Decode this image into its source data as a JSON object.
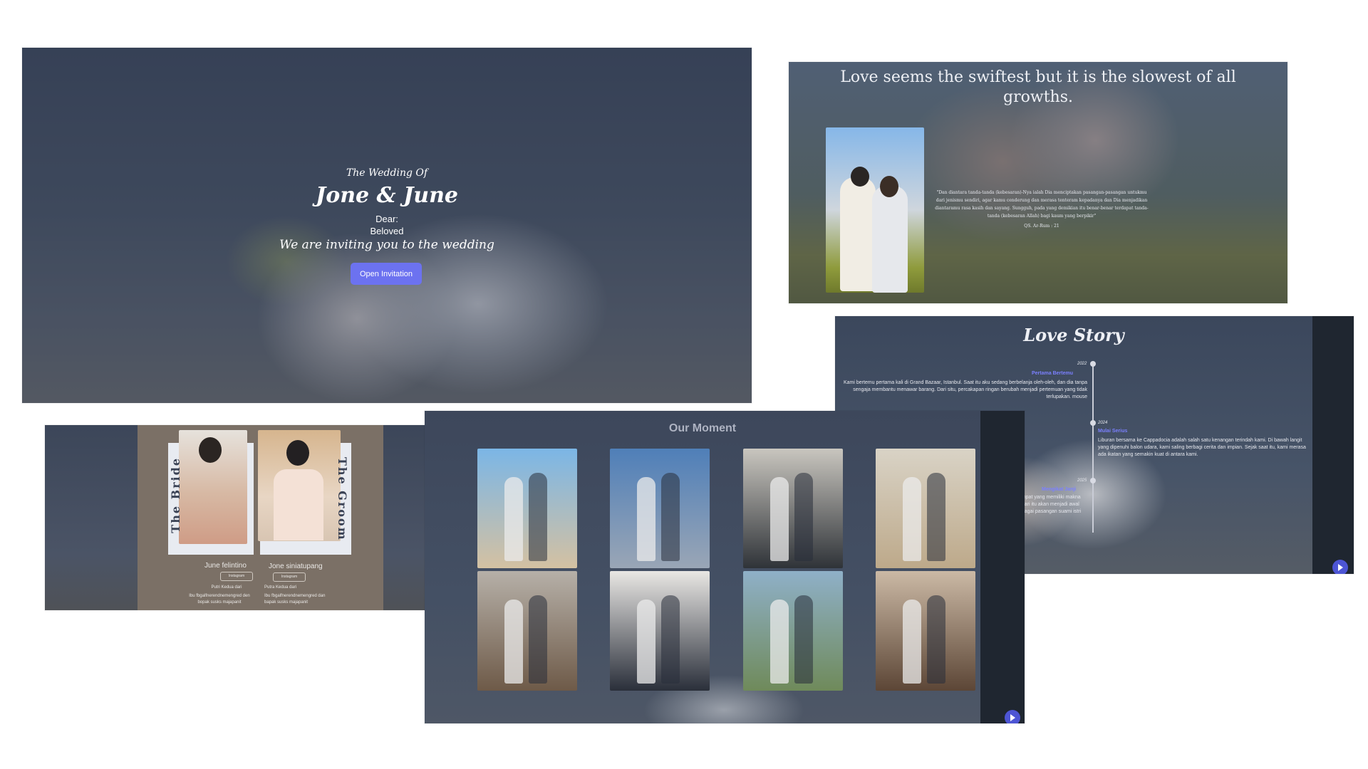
{
  "hero": {
    "subtitle": "The Wedding Of",
    "names": "Jone & June",
    "dear": "Dear:",
    "guest": "Beloved",
    "invite": "We are inviting you to the wedding",
    "button": "Open Invitation"
  },
  "quote": {
    "headline": "Love seems the swiftest but it is the slowest of all growths.",
    "verse": "\"Dan diantara tanda-tanda (kebesaran)-Nya ialah Dia menciptakan pasangan-pasangan untukmu dari jenismu sendiri, agar kamu cenderung dan merasa tenteram kepadanya dan Dia menjadikan diantaramu rasa kasih dan sayang. Sungguh, pada yang demikian itu benar-benar terdapat tanda-tanda (kebesaran Allah) bagi kaum yang berpikir\"",
    "source": "QS. Ar-Rum : 21"
  },
  "story": {
    "title": "Love Story",
    "events": [
      {
        "year": "2022",
        "title": "Pertama Bertemu",
        "text": "Kami bertemu pertama kali di Grand Bazaar, Istanbul. Saat itu aku sedang berbelanja oleh-oleh, dan dia tanpa sengaja membantu menawar barang. Dari situ, percakapan ringan berubah menjadi pertemuan yang tidak terlupakan. mouse"
      },
      {
        "year": "2024",
        "title": "Mulai Serius",
        "text": "Liburan bersama ke Cappadocia adalah salah satu kenangan terindah kami. Di bawah langit yang dipenuhi balon udara, kami saling berbagi cerita dan impian. Sejak saat itu, kami merasa ada ikatan yang semakin kuat di antara kami."
      },
      {
        "year": "2025",
        "title": "Mengikat Janji",
        "text": "...mpat yang memiliki makna ...hari itu akan menjadi awal ...bagai pasangan suami istri"
      }
    ]
  },
  "couple": {
    "bride_title": "The Bride",
    "groom_title": "The Groom",
    "bride": {
      "name": "June felintino",
      "instagram": "Instagram",
      "child": "Putri Kedua dari",
      "parents": "Ibu fbgalfnerendnemengred den bopak susks majapanit"
    },
    "groom": {
      "name": "Jone siniatupang",
      "instagram": "Instagram",
      "child": "Putra Kedua dari",
      "parents": "Ibu fbgalfnerendnemengred dan bapak susks majapanit"
    }
  },
  "gallery": {
    "title": "Our Moment",
    "photos": [
      {
        "c1": "#7bb6e6",
        "c2": "#d4c1a2"
      },
      {
        "c1": "#4f7fb8",
        "c2": "#9aa6b6"
      },
      {
        "c1": "#c9c6bf",
        "c2": "#2f3338"
      },
      {
        "c1": "#d9d3c6",
        "c2": "#bda98a"
      },
      {
        "c1": "#b6b0a8",
        "c2": "#6e5a48"
      },
      {
        "c1": "#e9e7e4",
        "c2": "#2a2f3a"
      },
      {
        "c1": "#8fb0c8",
        "c2": "#6f8a5a"
      },
      {
        "c1": "#cbb9a5",
        "c2": "#5c4636"
      }
    ]
  },
  "colors": {
    "accent": "#6c72f0",
    "timeline_title": "#7b80ff",
    "sidebar": "#1f2630"
  },
  "icons": [
    "play-icon",
    "check-circle-icon",
    "instagram-icon"
  ]
}
